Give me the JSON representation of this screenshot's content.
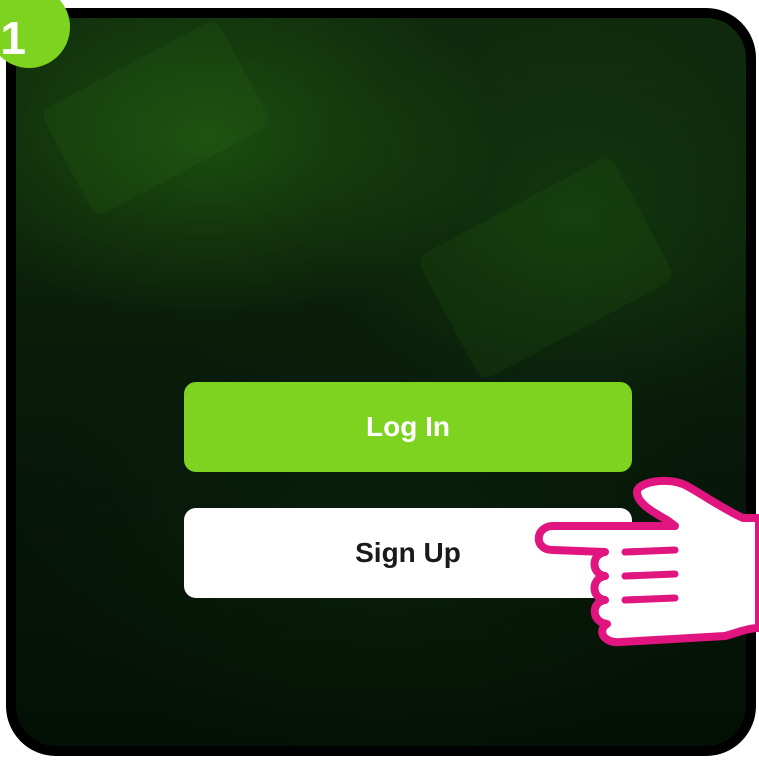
{
  "step_badge": {
    "number": "1",
    "color": "#7ed321"
  },
  "buttons": {
    "login_label": "Log In",
    "signup_label": "Sign Up"
  },
  "colors": {
    "accent": "#7ed321",
    "hand_outline": "#e0157f",
    "background_dark": "#0b2009"
  },
  "icons": {
    "pointer": "pointing-hand-icon"
  }
}
